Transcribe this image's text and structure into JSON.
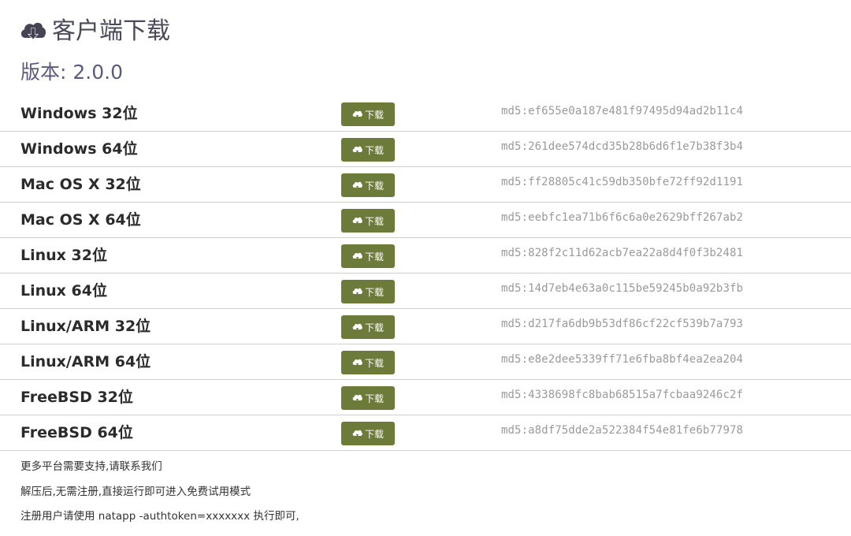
{
  "header": {
    "icon": "cloud-download-icon",
    "title": "客户端下载"
  },
  "version": "版本: 2.0.0",
  "downloads": [
    {
      "name": "Windows 32位",
      "button": "下载",
      "md5": "md5:ef655e0a187e481f97495d94ad2b11c4"
    },
    {
      "name": "Windows 64位",
      "button": "下载",
      "md5": "md5:261dee574dcd35b28b6d6f1e7b38f3b4"
    },
    {
      "name": "Mac OS X 32位",
      "button": "下载",
      "md5": "md5:ff28805c41c59db350bfe72ff92d1191"
    },
    {
      "name": "Mac OS X 64位",
      "button": "下载",
      "md5": "md5:eebfc1ea71b6f6c6a0e2629bff267ab2"
    },
    {
      "name": "Linux 32位",
      "button": "下载",
      "md5": "md5:828f2c11d62acb7ea22a8d4f0f3b2481"
    },
    {
      "name": "Linux 64位",
      "button": "下载",
      "md5": "md5:14d7eb4e63a0c115be59245b0a92b3fb"
    },
    {
      "name": "Linux/ARM 32位",
      "button": "下载",
      "md5": "md5:d217fa6db9b53df86cf22cf539b7a793"
    },
    {
      "name": "Linux/ARM 64位",
      "button": "下载",
      "md5": "md5:e8e2dee5339ff71e6fba8bf4ea2ea204"
    },
    {
      "name": "FreeBSD 32位",
      "button": "下载",
      "md5": "md5:4338698fc8bab68515a7fcbaa9246c2f"
    },
    {
      "name": "FreeBSD 64位",
      "button": "下载",
      "md5": "md5:a8df75dde2a522384f54e81fe6b77978"
    }
  ],
  "notes": [
    "更多平台需要支持,请联系我们",
    "解压后,无需注册,直接运行即可进入免费试用模式",
    "注册用户请使用 natapp -authtoken=xxxxxxx 执行即可,"
  ],
  "colors": {
    "button": "#6c7a3a",
    "title": "#4a4a5a",
    "version": "#5c5a7c",
    "md5": "#9a9a9a"
  }
}
